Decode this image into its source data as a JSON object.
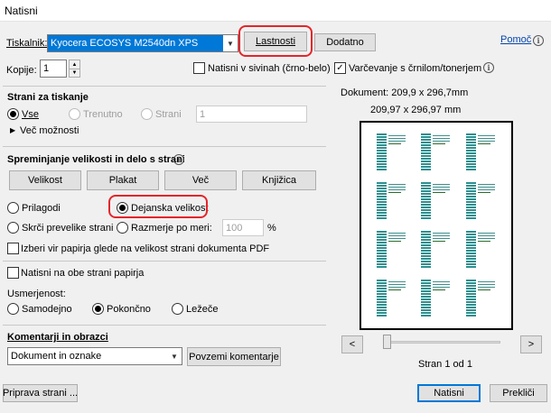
{
  "window": {
    "title": "Natisni"
  },
  "top": {
    "printer_label": "Tiskalnik:",
    "printer_value": "Kyocera ECOSYS M2540dn XPS",
    "properties_button": "Lastnosti",
    "advanced_button": "Dodatno",
    "help_link": "Pomoč",
    "copies_label": "Kopije:",
    "copies_value": "1",
    "grayscale_label": "Natisni v sivinah (črno-belo)",
    "save_ink_label": "Varčevanje s črnilom/tonerjem"
  },
  "pages": {
    "title": "Strani za tiskanje",
    "all": "Vse",
    "current": "Trenutno",
    "pages": "Strani",
    "pages_value": "1",
    "more": "Več možnosti"
  },
  "sizing": {
    "title": "Spreminjanje velikosti in delo s strani",
    "tabs": [
      "Velikost",
      "Plakat",
      "Več",
      "Knjižica"
    ],
    "fit": "Prilagodi",
    "actual": "Dejanska velikost",
    "shrink": "Skrči prevelike strani",
    "custom": "Razmerje po meri:",
    "custom_value": "100",
    "percent": "%",
    "paper_source": "Izberi vir papirja glede na velikost strani dokumenta PDF"
  },
  "duplex": {
    "label": "Natisni na obe strani papirja"
  },
  "orientation": {
    "title": "Usmerjenost:",
    "auto": "Samodejno",
    "portrait": "Pokončno",
    "landscape": "Ležeče"
  },
  "comments": {
    "title": "Komentarji in obrazci",
    "value": "Dokument in oznake",
    "summarize_button": "Povzemi komentarje"
  },
  "preview": {
    "document_size": "Dokument: 209,9 x 296,7mm",
    "page_size": "209,97 x 296,97 mm",
    "prev": "<",
    "next": ">",
    "page_counter": "Stran 1 od 1"
  },
  "footer": {
    "page_setup": "Priprava strani ...",
    "print": "Natisni",
    "cancel": "Prekliči"
  },
  "colors": {
    "accent": "#0078d7",
    "highlight_ring": "#e3262b",
    "label_teal": "#2e8f8f"
  }
}
